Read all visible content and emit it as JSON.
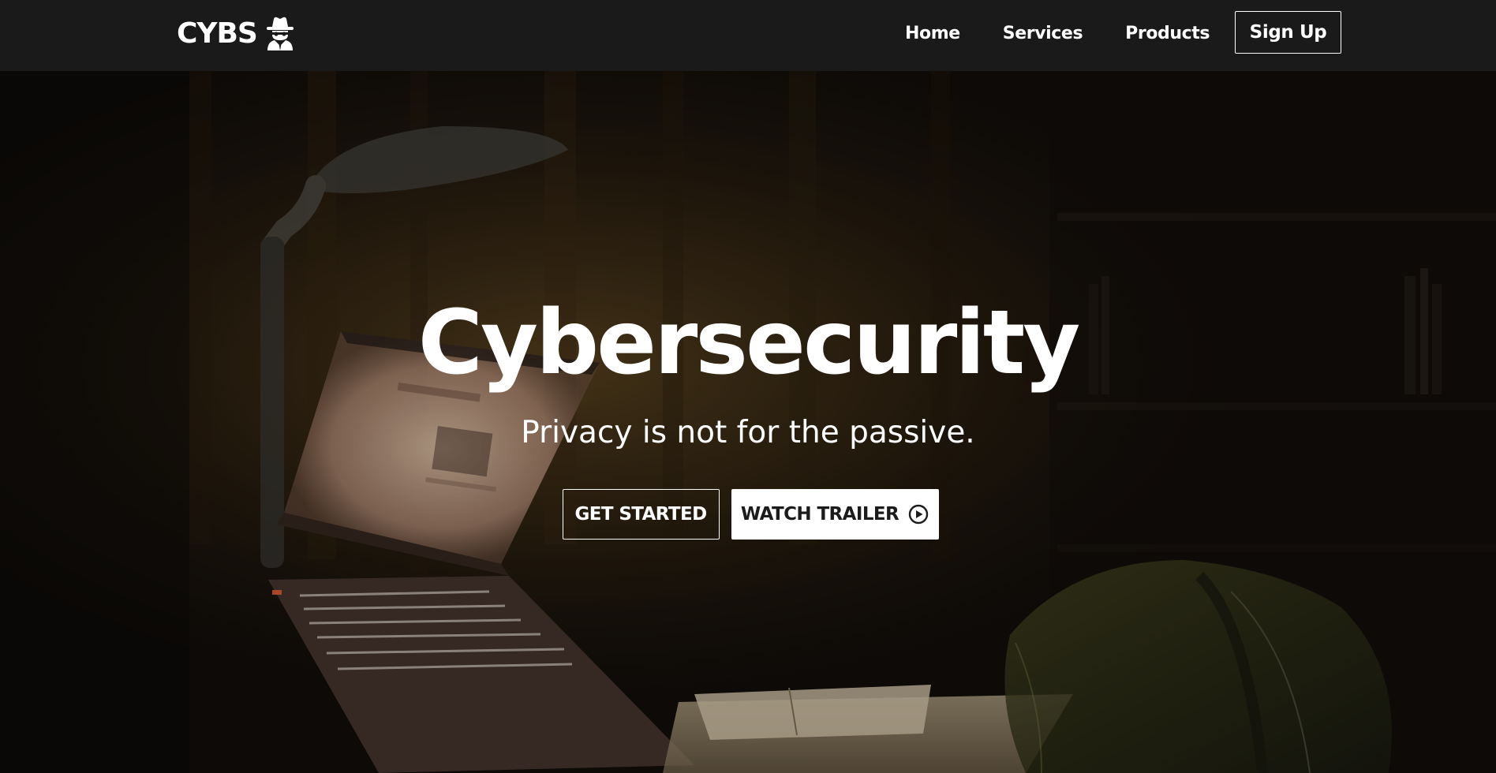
{
  "brand": {
    "name": "CYBS",
    "icon": "spy-icon"
  },
  "nav": {
    "links": [
      {
        "label": "Home"
      },
      {
        "label": "Services"
      },
      {
        "label": "Products"
      }
    ],
    "signup_label": "Sign Up"
  },
  "hero": {
    "title": "Cybersecurity",
    "subtitle": "Privacy is not for the passive.",
    "primary_button": "GET STARTED",
    "secondary_button": "WATCH TRAILER",
    "secondary_button_icon": "play-circle-icon"
  },
  "colors": {
    "navbar_bg": "#1b1a1a",
    "text": "#ffffff",
    "solid_button_bg": "#ffffff",
    "solid_button_text": "#1c1c1c"
  }
}
